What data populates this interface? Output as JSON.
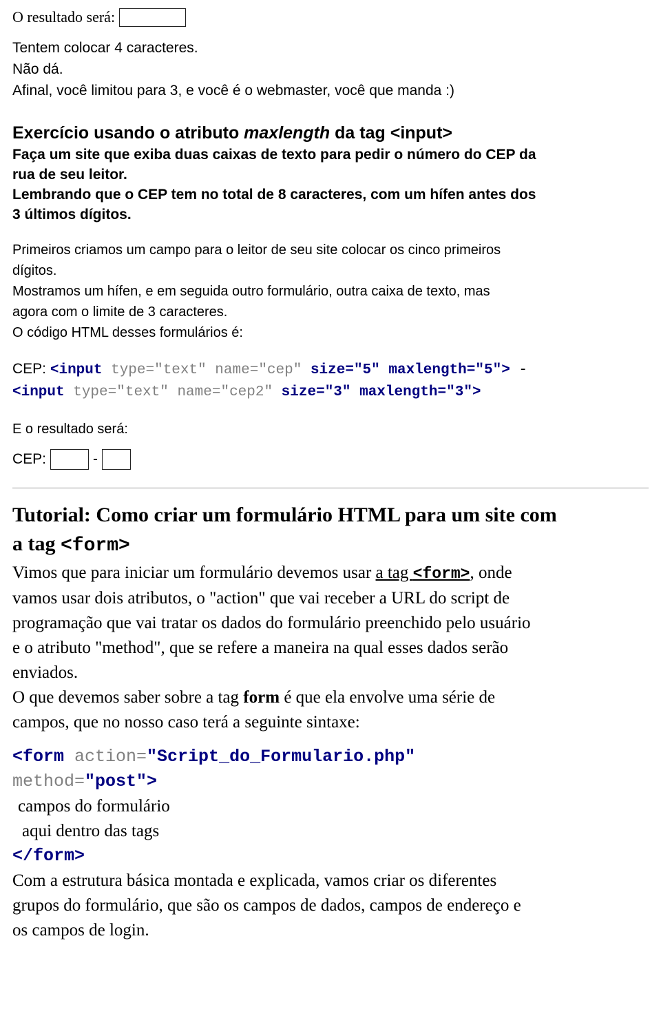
{
  "top": {
    "result_label": "O resultado será:",
    "note1": "Tentem colocar 4 caracteres.",
    "note2": "Não dá.",
    "note3": "Afinal, você limitou para 3, e você é o webmaster, você que manda :)"
  },
  "exercise": {
    "heading_prefix": "Exercício usando o atributo ",
    "heading_em": "maxlength",
    "heading_suffix": " da tag <input>",
    "line1": "Faça um site que exiba duas caixas de texto para pedir o número do CEP da",
    "line2": "rua de seu leitor.",
    "line3": "Lembrando que o CEP tem no total de 8 caracteres, com um hífen antes dos",
    "line4": "3 últimos dígitos.",
    "para1_l1": "Primeiros criamos um campo para o leitor de seu site colocar os cinco primeiros",
    "para1_l2": "dígitos.",
    "para1_l3": "Mostramos um hífen, e em seguida outro formulário, outra caixa de texto, mas",
    "para1_l4": "agora com o limite de 3 caracteres.",
    "para1_l5": "O código HTML desses formulários é:",
    "code": {
      "label": "CEP: ",
      "tag1_open": "<input",
      "tag1_attrs": " type=\"text\" name=\"cep\"",
      "tag1_size": " size=\"5\" maxlength=\"5\">",
      "dash": " -",
      "tag2_open": "<input",
      "tag2_attrs": " type=\"text\" name=\"cep2\"",
      "tag2_size": " size=\"3\" maxlength=\"3\">"
    },
    "result_label": "E o resultado será:",
    "cep_label": "CEP:",
    "cep_dash": "-"
  },
  "tutorial": {
    "title_line1": "Tutorial: Como criar um formulário HTML para um site com",
    "title_line2_prefix": "a tag ",
    "title_line2_mono": "<form>",
    "p1_a": "Vimos que para iniciar um formulário devemos usar ",
    "p1_link": "a tag ",
    "p1_link_mono": "<form>",
    "p1_b": ", onde",
    "p1_l2": "vamos usar dois atributos, o \"action\" que vai receber a URL do script de",
    "p1_l3": "programação que vai tratar os dados do formulário preenchido pelo usuário",
    "p1_l4": "e o atributo \"method\", que se refere a maneira na qual esses dados serão",
    "p1_l5": "enviados.",
    "p2_a": "O que devemos saber sobre a tag ",
    "p2_b": "form",
    "p2_c": " é que ela envolve uma série de",
    "p2_l2": "campos, que no nosso caso terá a seguinte sintaxe:",
    "form_code": {
      "open_tag": "<form",
      "action_attr": " action=",
      "action_val": "\"Script_do_Formulario.php\"",
      "method_attr": "method=",
      "method_val": "\"post\"",
      "gt": ">",
      "inner_l1": "campos do formulário",
      "inner_l2": "aqui dentro das tags",
      "close_tag": "</form>"
    },
    "p3_l1": "Com a estrutura básica montada e explicada, vamos criar os diferentes",
    "p3_l2": "grupos do formulário, que são os campos de dados, campos de endereço e",
    "p3_l3": "os campos de login."
  }
}
